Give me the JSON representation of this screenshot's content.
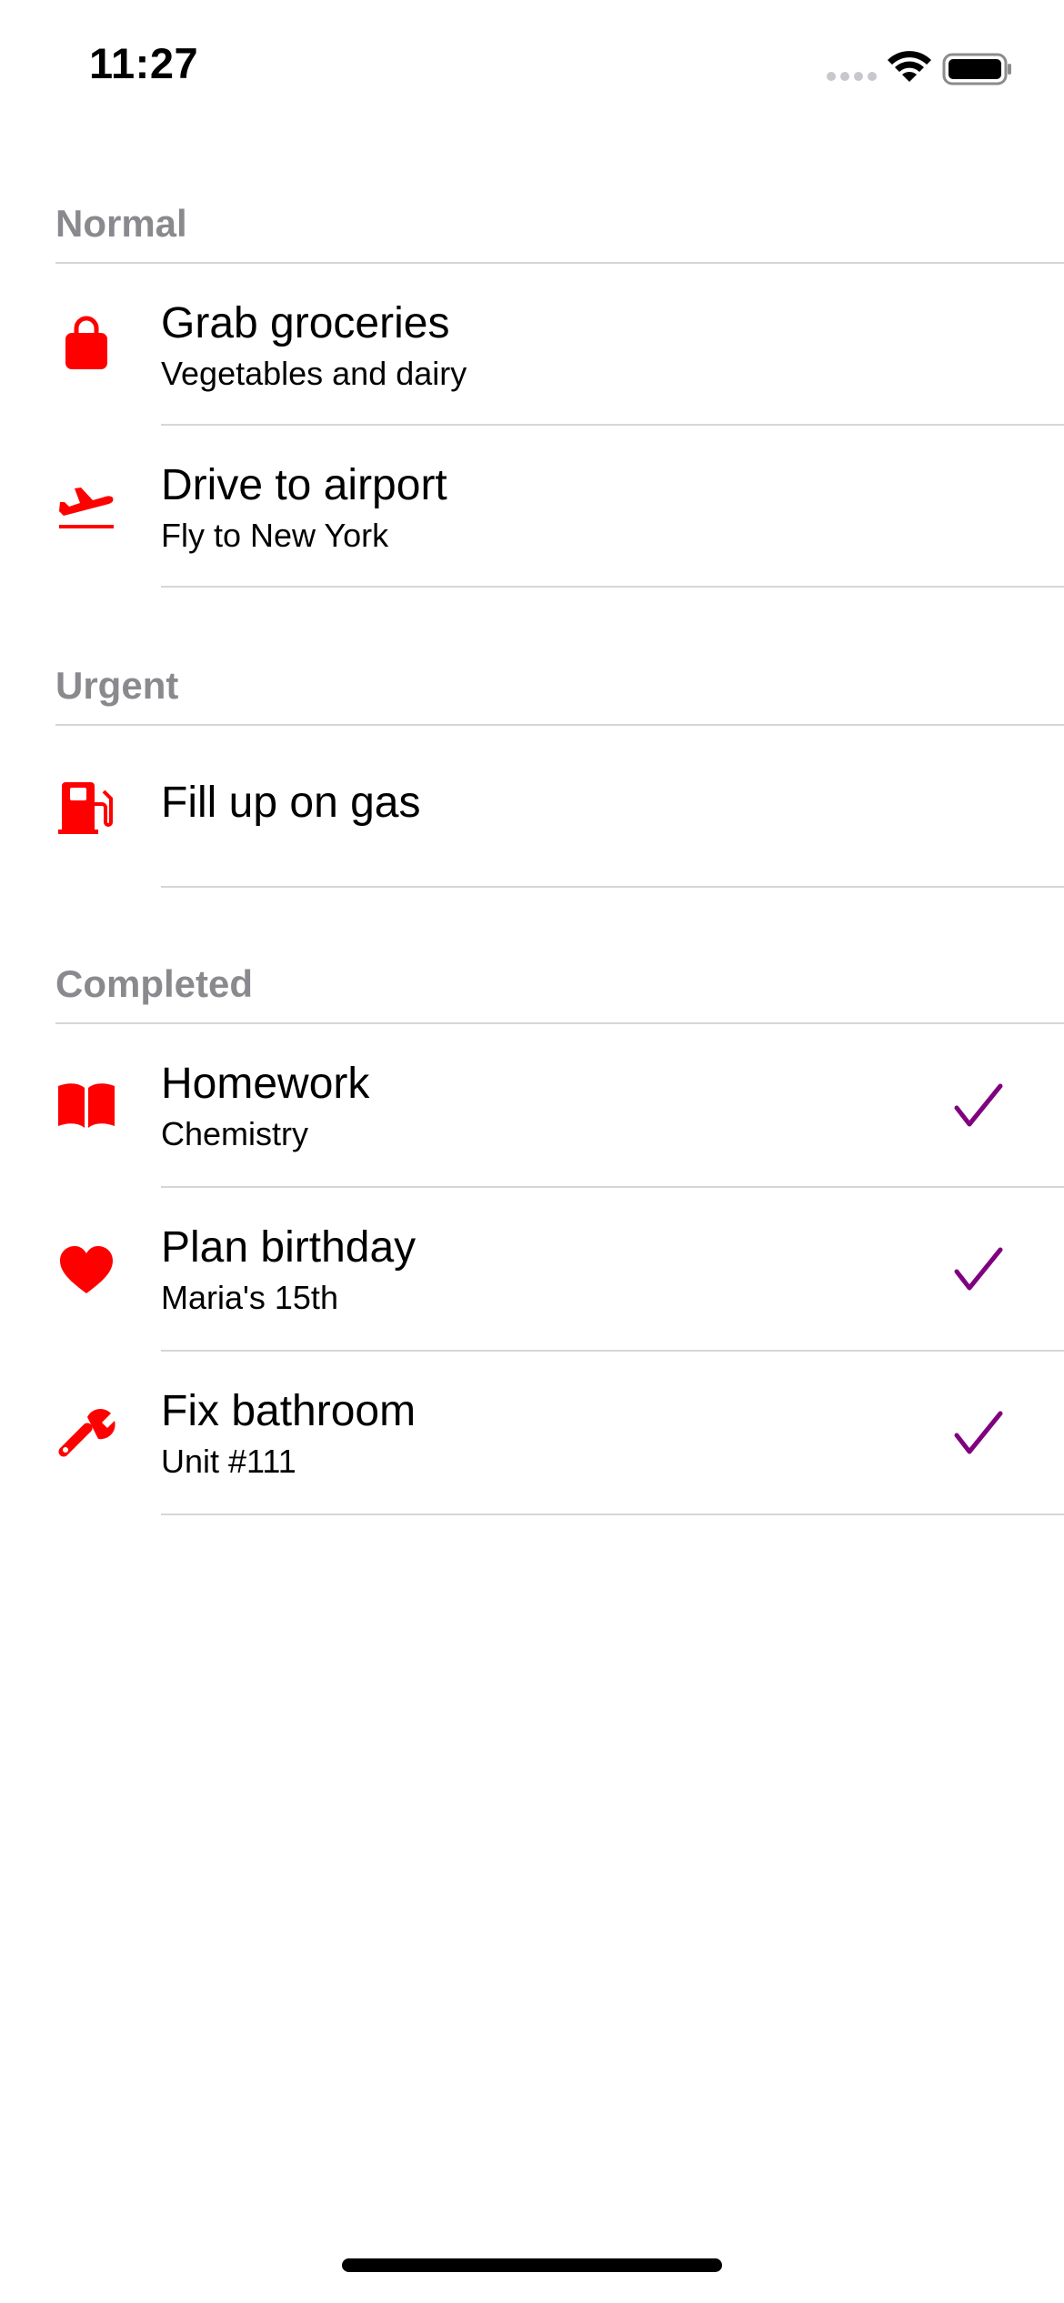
{
  "status_bar": {
    "time": "11:27"
  },
  "colors": {
    "accent": "#ff0000",
    "check": "#800080",
    "section_header": "#8a8a8e"
  },
  "sections": [
    {
      "title": "Normal",
      "items": [
        {
          "title": "Grab groceries",
          "subtitle": "Vegetables and dairy",
          "icon": "shopping-bag-icon",
          "completed": false
        },
        {
          "title": "Drive to airport",
          "subtitle": "Fly to New York",
          "icon": "airplane-departure-icon",
          "completed": false
        }
      ]
    },
    {
      "title": "Urgent",
      "items": [
        {
          "title": "Fill up on gas",
          "subtitle": "",
          "icon": "fuel-pump-icon",
          "completed": false
        }
      ]
    },
    {
      "title": "Completed",
      "items": [
        {
          "title": "Homework",
          "subtitle": "Chemistry",
          "icon": "book-icon",
          "completed": true
        },
        {
          "title": "Plan birthday",
          "subtitle": "Maria's 15th",
          "icon": "heart-icon",
          "completed": true
        },
        {
          "title": "Fix bathroom",
          "subtitle": "Unit #111",
          "icon": "wrench-icon",
          "completed": true
        }
      ]
    }
  ]
}
